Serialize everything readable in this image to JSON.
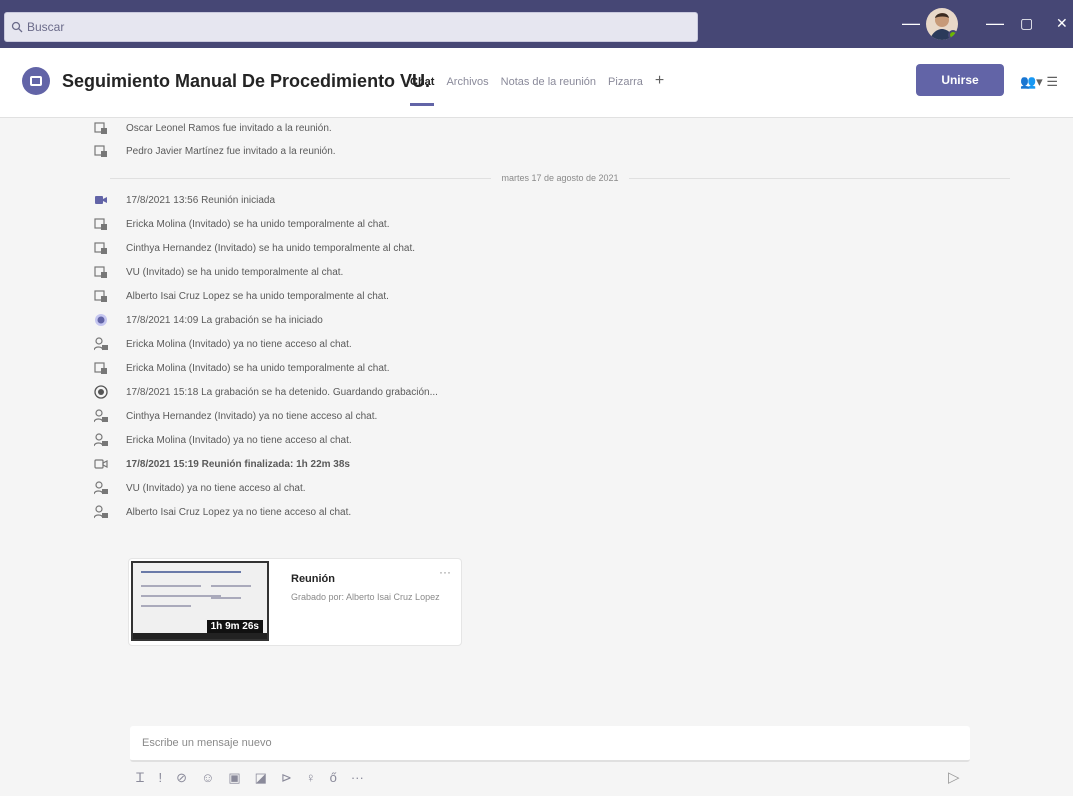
{
  "search": {
    "placeholder": "Buscar"
  },
  "window": {
    "minimize": "—",
    "restore": "▢",
    "close": "✕"
  },
  "header": {
    "title": "Seguimiento Manual De Procedimiento VU.",
    "tabs": [
      {
        "label": "Chat",
        "active": true
      },
      {
        "label": "Archivos"
      },
      {
        "label": "Notas de la reunión"
      },
      {
        "label": "Pizarra"
      }
    ],
    "add_tab": "+",
    "join_label": "Unirse",
    "icons": [
      "participants-icon",
      "more-icon"
    ]
  },
  "messages": [
    {
      "text": "Oscar Leonel Ramos fue invitado a la reunión.",
      "icon": "add-user-icon"
    },
    {
      "text": "Pedro Javier Martínez fue invitado a la reunión.",
      "icon": "add-user-icon"
    },
    {
      "text": "martes 17 de agosto de 2021",
      "type": "date"
    },
    {
      "text": "17/8/2021 13:56   Reunión iniciada",
      "icon": "video-icon"
    },
    {
      "text": "Ericka Molina (Invitado) se ha unido temporalmente al chat.",
      "icon": "add-user-icon"
    },
    {
      "text": "Cinthya Hernandez (Invitado) se ha unido temporalmente al chat.",
      "icon": "add-user-icon"
    },
    {
      "text": "VU (Invitado) se ha unido temporalmente al chat.",
      "icon": "add-user-icon"
    },
    {
      "text": "Alberto Isai Cruz Lopez se ha unido temporalmente al chat.",
      "icon": "add-user-icon"
    },
    {
      "text": "17/8/2021 14:09   La grabación se ha iniciado",
      "icon": "record-icon"
    },
    {
      "text": "Ericka Molina (Invitado) ya no tiene acceso al chat.",
      "icon": "remove-user-icon"
    },
    {
      "text": "Ericka Molina (Invitado) se ha unido temporalmente al chat.",
      "icon": "add-user-icon"
    },
    {
      "text": "17/8/2021 15:18   La grabación se ha detenido. Guardando grabación...",
      "icon": "stop-record-icon"
    },
    {
      "text": "Cinthya Hernandez (Invitado) ya no tiene acceso al chat.",
      "icon": "remove-user-icon"
    },
    {
      "text": "Ericka Molina (Invitado) ya no tiene acceso al chat.",
      "icon": "remove-user-icon"
    },
    {
      "text": "17/8/2021 15:19   Reunión finalizada: 1h 22m 38s",
      "icon": "video-end-icon"
    },
    {
      "text": "VU (Invitado) ya no tiene acceso al chat.",
      "icon": "remove-user-icon"
    },
    {
      "text": "Alberto Isai Cruz Lopez ya no tiene acceso al chat.",
      "icon": "remove-user-icon"
    }
  ],
  "recording": {
    "title": "Reunión",
    "subtitle": "Grabado por: Alberto Isai Cruz Lopez",
    "duration": "1h 9m 26s",
    "more": "···"
  },
  "compose": {
    "placeholder": "Escribe un mensaje nuevo"
  },
  "toolbar": [
    "format-icon",
    "priority-icon",
    "attach-icon",
    "emoji-icon",
    "gif-icon",
    "sticker-icon",
    "meet-now-icon",
    "praise-icon",
    "loop-icon",
    "more-options-icon"
  ],
  "colors": {
    "titlebar": "#464775",
    "accent": "#6264a7",
    "background": "#f5f5f5"
  }
}
